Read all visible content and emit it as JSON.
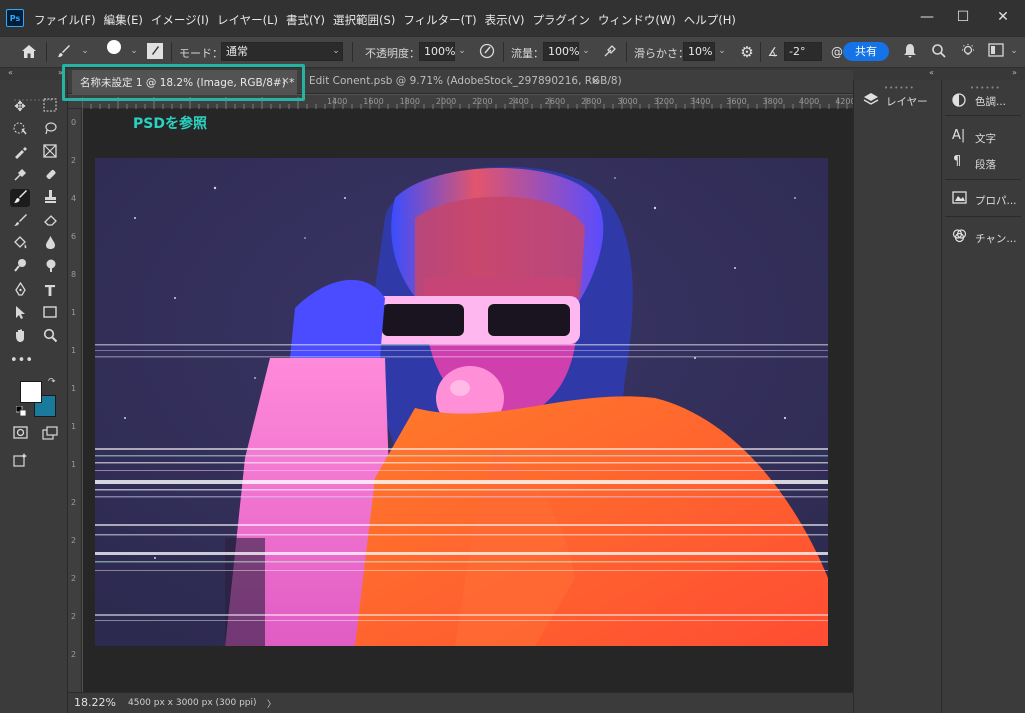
{
  "app": {
    "logo": "Ps",
    "menu": [
      "ファイル(F)",
      "編集(E)",
      "イメージ(I)",
      "レイヤー(L)",
      "書式(Y)",
      "選択範囲(S)",
      "フィルター(T)",
      "表示(V)",
      "プラグイン",
      "ウィンドウ(W)",
      "ヘルプ(H)"
    ],
    "window_controls": {
      "minimize": "—",
      "maximize": "☐",
      "close": "✕"
    }
  },
  "options": {
    "mode_label": "モード：",
    "mode_value": "通常",
    "opacity_label": "不透明度：",
    "opacity_value": "100%",
    "flow_label": "流量：",
    "flow_value": "100%",
    "smoothing_label": "滑らかさ：",
    "smoothing_value": "10%",
    "angle_value": "-2°",
    "share_label": "共有"
  },
  "tabs": [
    {
      "label": "名称未設定 1 @ 18.2% (Image, RGB/8#) *",
      "close": "×"
    },
    {
      "label": "Edit Conent.psb @ 9.71% (AdobeStock_297890216, RGB/8)",
      "close": "×"
    }
  ],
  "annotation": "PSDを参照",
  "ruler": {
    "top_ticks": [
      "1400",
      "1600",
      "1800",
      "2000",
      "2200",
      "2400",
      "2600",
      "2800",
      "3000",
      "3200",
      "3400",
      "3600",
      "3800",
      "4000",
      "4200",
      "4400"
    ],
    "left_ticks": [
      "0",
      "2",
      "4",
      "6",
      "8",
      "1",
      "1",
      "1",
      "1",
      "1",
      "2",
      "2",
      "2",
      "2",
      "2"
    ]
  },
  "status": {
    "zoom": "18.22%",
    "doc_info": "4500 px x 3000 px (300 ppi)",
    "arrow": "〉"
  },
  "panels": {
    "dock1": [
      {
        "icon": "layers-icon",
        "label": "レイヤー"
      }
    ],
    "dock2": [
      {
        "icon": "color-icon",
        "label": "色調..."
      },
      {
        "icon": "character-icon",
        "label": "文字"
      },
      {
        "icon": "paragraph-icon",
        "label": "段落"
      },
      {
        "icon": "properties-icon",
        "label": "プロパ..."
      },
      {
        "icon": "channels-icon",
        "label": "チャン..."
      }
    ]
  },
  "colors": {
    "foreground": "#ffffff",
    "background": "#1a7a9c",
    "accent": "#27b3a3",
    "share": "#1473e6"
  }
}
